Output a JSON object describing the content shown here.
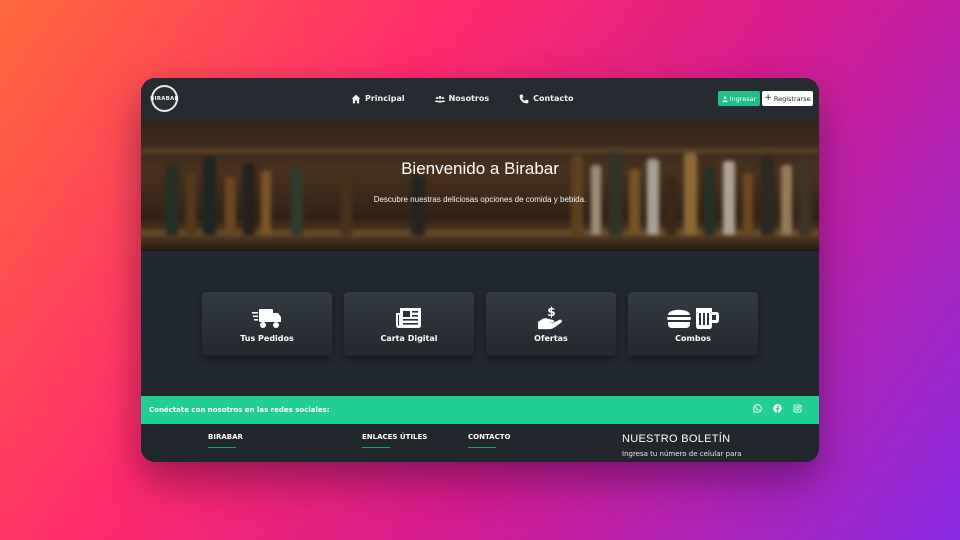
{
  "brand": {
    "logo_text": "BIRABAR"
  },
  "nav": {
    "items": [
      {
        "label": "Principal",
        "icon": "home-icon"
      },
      {
        "label": "Nosotros",
        "icon": "users-icon"
      },
      {
        "label": "Contacto",
        "icon": "phone-icon"
      }
    ],
    "login_label": "Ingresar",
    "register_label": "Registrarse"
  },
  "hero": {
    "title": "Bienvenido a Birabar",
    "subtitle": "Descubre nuestras deliciosas opciones de comida y bebida."
  },
  "cards": [
    {
      "label": "Tus Pedidos",
      "icon": "delivery-truck-icon"
    },
    {
      "label": "Carta Digital",
      "icon": "newspaper-icon"
    },
    {
      "label": "Ofertas",
      "icon": "hand-dollar-icon"
    },
    {
      "label": "Combos",
      "icon": "burger-beer-icon"
    }
  ],
  "social": {
    "text": "Conéctate con nosotros en las redes sociales:",
    "icons": [
      "whatsapp-icon",
      "facebook-icon",
      "instagram-icon"
    ]
  },
  "footer": {
    "col1_title": "BIRABAR",
    "col2_title": "ENLACES ÚTILES",
    "col3_title": "CONTACTO",
    "newsletter_title": "NUESTRO BOLETÍN",
    "newsletter_text": "Ingresa tu número de celular para"
  },
  "colors": {
    "accent": "#22cf93",
    "navbar": "#262b32",
    "background": "#22282f"
  }
}
